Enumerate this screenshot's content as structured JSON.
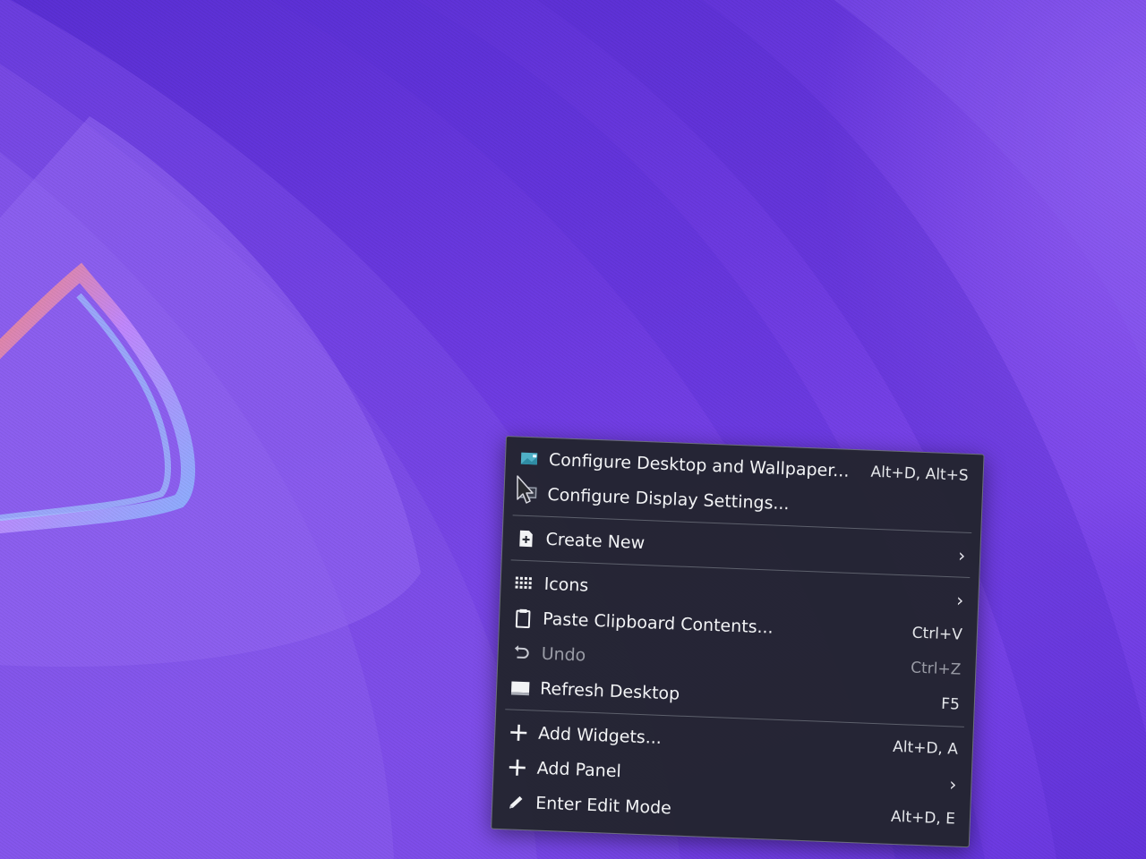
{
  "context_menu": {
    "items": [
      {
        "label": "Configure Desktop and Wallpaper...",
        "shortcut": "Alt+D, Alt+S",
        "icon": "wallpaper-icon"
      },
      {
        "label": "Configure Display Settings...",
        "shortcut": "",
        "icon": "display-icon"
      },
      {
        "label": "Create New",
        "shortcut": "",
        "icon": "new-file-icon",
        "submenu": true
      },
      {
        "label": "Icons",
        "shortcut": "",
        "icon": "grid-icon",
        "submenu": true
      },
      {
        "label": "Paste Clipboard Contents...",
        "shortcut": "Ctrl+V",
        "icon": "clipboard-icon"
      },
      {
        "label": "Undo",
        "shortcut": "Ctrl+Z",
        "icon": "undo-icon",
        "disabled": true
      },
      {
        "label": "Refresh Desktop",
        "shortcut": "F5",
        "icon": "refresh-desktop-icon"
      },
      {
        "label": "Add Widgets...",
        "shortcut": "Alt+D, A",
        "icon": "plus-icon"
      },
      {
        "label": "Add Panel",
        "shortcut": "",
        "icon": "plus-icon",
        "submenu": true
      },
      {
        "label": "Enter Edit Mode",
        "shortcut": "Alt+D, E",
        "icon": "pencil-icon"
      }
    ],
    "submenu_glyph": "›"
  },
  "colors": {
    "wallpaper_base": "#6a35dc",
    "menu_background": "#22242e",
    "accent_orange": "#ff8a6a",
    "accent_blue": "#8ab8ff"
  }
}
